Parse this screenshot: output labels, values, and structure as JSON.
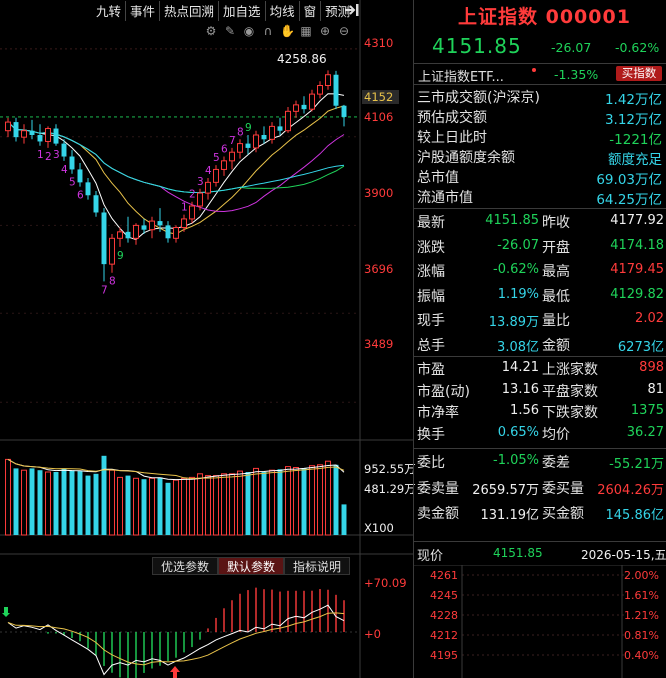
{
  "toolbar": {
    "items": [
      "九转",
      "事件",
      "热点回溯",
      "加自选",
      "均线",
      "窗",
      "预测"
    ]
  },
  "tool_icons": [
    "gear-icon",
    "pencil-icon",
    "eye-icon",
    "magnet-icon",
    "hand-icon",
    "grid-icon",
    "zoom-in-icon",
    "zoom-out-icon"
  ],
  "main_chart": {
    "axis_labels": [
      "4310",
      "4152",
      "4106",
      "3900",
      "3696",
      "3489"
    ],
    "current_price_tag": "4152",
    "high_annotation": "4258.86",
    "volume_axis": [
      "952.55万",
      "481.29万",
      "X100"
    ],
    "indicator_axis": [
      "+70.09",
      "+0"
    ]
  },
  "chart_data": {
    "type": "candlestick",
    "y_ticks": [
      4310,
      4106,
      3900,
      3696,
      3489
    ],
    "y_range": [
      3420,
      4340
    ],
    "candles": [
      {
        "o": 4120,
        "h": 4150,
        "l": 4105,
        "c": 4140
      },
      {
        "o": 4140,
        "h": 4150,
        "l": 4095,
        "c": 4105
      },
      {
        "o": 4105,
        "h": 4135,
        "l": 4090,
        "c": 4120
      },
      {
        "o": 4120,
        "h": 4145,
        "l": 4100,
        "c": 4110
      },
      {
        "o": 4110,
        "h": 4135,
        "l": 4085,
        "c": 4095
      },
      {
        "o": 4095,
        "h": 4130,
        "l": 4080,
        "c": 4125
      },
      {
        "o": 4125,
        "h": 4135,
        "l": 4085,
        "c": 4090
      },
      {
        "o": 4090,
        "h": 4100,
        "l": 4050,
        "c": 4060
      },
      {
        "o": 4060,
        "h": 4075,
        "l": 4020,
        "c": 4030
      },
      {
        "o": 4030,
        "h": 4045,
        "l": 3990,
        "c": 4000
      },
      {
        "o": 4000,
        "h": 4010,
        "l": 3960,
        "c": 3970
      },
      {
        "o": 3970,
        "h": 3980,
        "l": 3920,
        "c": 3930
      },
      {
        "o": 3930,
        "h": 3940,
        "l": 3770,
        "c": 3810
      },
      {
        "o": 3810,
        "h": 3880,
        "l": 3790,
        "c": 3870
      },
      {
        "o": 3870,
        "h": 3895,
        "l": 3850,
        "c": 3885
      },
      {
        "o": 3885,
        "h": 3920,
        "l": 3860,
        "c": 3870
      },
      {
        "o": 3870,
        "h": 3905,
        "l": 3855,
        "c": 3900
      },
      {
        "o": 3900,
        "h": 3915,
        "l": 3880,
        "c": 3890
      },
      {
        "o": 3890,
        "h": 3920,
        "l": 3870,
        "c": 3910
      },
      {
        "o": 3910,
        "h": 3940,
        "l": 3885,
        "c": 3900
      },
      {
        "o": 3900,
        "h": 3910,
        "l": 3860,
        "c": 3870
      },
      {
        "o": 3870,
        "h": 3900,
        "l": 3860,
        "c": 3895
      },
      {
        "o": 3895,
        "h": 3925,
        "l": 3885,
        "c": 3915
      },
      {
        "o": 3915,
        "h": 3955,
        "l": 3905,
        "c": 3945
      },
      {
        "o": 3945,
        "h": 3985,
        "l": 3935,
        "c": 3975
      },
      {
        "o": 3975,
        "h": 4010,
        "l": 3960,
        "c": 4000
      },
      {
        "o": 4000,
        "h": 4040,
        "l": 3990,
        "c": 4030
      },
      {
        "o": 4030,
        "h": 4060,
        "l": 4015,
        "c": 4050
      },
      {
        "o": 4050,
        "h": 4080,
        "l": 4030,
        "c": 4070
      },
      {
        "o": 4070,
        "h": 4100,
        "l": 4055,
        "c": 4090
      },
      {
        "o": 4090,
        "h": 4110,
        "l": 4065,
        "c": 4080
      },
      {
        "o": 4080,
        "h": 4120,
        "l": 4070,
        "c": 4110
      },
      {
        "o": 4110,
        "h": 4130,
        "l": 4090,
        "c": 4100
      },
      {
        "o": 4100,
        "h": 4140,
        "l": 4090,
        "c": 4130
      },
      {
        "o": 4130,
        "h": 4150,
        "l": 4110,
        "c": 4120
      },
      {
        "o": 4120,
        "h": 4175,
        "l": 4115,
        "c": 4165
      },
      {
        "o": 4165,
        "h": 4190,
        "l": 4150,
        "c": 4180
      },
      {
        "o": 4180,
        "h": 4200,
        "l": 4160,
        "c": 4170
      },
      {
        "o": 4170,
        "h": 4215,
        "l": 4165,
        "c": 4205
      },
      {
        "o": 4205,
        "h": 4235,
        "l": 4195,
        "c": 4225
      },
      {
        "o": 4225,
        "h": 4260,
        "l": 4215,
        "c": 4250
      },
      {
        "o": 4250,
        "h": 4259,
        "l": 4170,
        "c": 4178
      },
      {
        "o": 4178,
        "h": 4180,
        "l": 4130,
        "c": 4152
      }
    ],
    "volumes": [
      0.84,
      0.74,
      0.72,
      0.74,
      0.72,
      0.7,
      0.7,
      0.74,
      0.72,
      0.71,
      0.66,
      0.68,
      0.88,
      0.72,
      0.64,
      0.66,
      0.63,
      0.62,
      0.63,
      0.64,
      0.58,
      0.61,
      0.63,
      0.64,
      0.68,
      0.66,
      0.66,
      0.68,
      0.68,
      0.71,
      0.7,
      0.74,
      0.7,
      0.72,
      0.73,
      0.76,
      0.75,
      0.74,
      0.77,
      0.78,
      0.82,
      0.78,
      0.34
    ],
    "nine_turn_labels": [
      {
        "i": 4,
        "t": "1"
      },
      {
        "i": 5,
        "t": "2"
      },
      {
        "i": 6,
        "t": "3"
      },
      {
        "i": 7,
        "t": "4"
      },
      {
        "i": 8,
        "t": "5"
      },
      {
        "i": 9,
        "t": "6"
      },
      {
        "i": 12,
        "t": "7"
      },
      {
        "i": 13,
        "t": "8"
      },
      {
        "i": 14,
        "t": "9"
      },
      {
        "i": 22,
        "t": "1"
      },
      {
        "i": 23,
        "t": "2"
      },
      {
        "i": 24,
        "t": "3"
      },
      {
        "i": 25,
        "t": "4"
      },
      {
        "i": 26,
        "t": "5"
      },
      {
        "i": 27,
        "t": "6"
      },
      {
        "i": 28,
        "t": "7"
      },
      {
        "i": 29,
        "t": "8"
      },
      {
        "i": 30,
        "t": "9"
      }
    ]
  },
  "tabs": {
    "items": [
      "优选参数",
      "默认参数",
      "指标说明"
    ]
  },
  "right": {
    "title": "上证指数 000001",
    "price": "4151.85",
    "change": "-26.07",
    "change_pct": "-0.62%",
    "etf": {
      "name": "上证指数ETF...",
      "pct": "-1.35%",
      "button": "买指数"
    },
    "market_stats": [
      {
        "label": "三市成交额(沪深京)",
        "value": "1.42万亿",
        "color": "c"
      },
      {
        "label": "预估成交额",
        "value": "3.12万亿",
        "color": "c"
      },
      {
        "label": "较上日此时",
        "value": "-1221亿",
        "color": "g"
      },
      {
        "label": "沪股通额度余额",
        "value": "额度充足",
        "color": "c"
      },
      {
        "label": "总市值",
        "value": "69.03万亿",
        "color": "c"
      },
      {
        "label": "流通市值",
        "value": "64.25万亿",
        "color": "c"
      }
    ],
    "quote": [
      {
        "l1": "最新",
        "v1": "4151.85",
        "c1": "g",
        "l2": "昨收",
        "v2": "4177.92",
        "c2": "w"
      },
      {
        "l1": "涨跌",
        "v1": "-26.07",
        "c1": "g",
        "l2": "开盘",
        "v2": "4174.18",
        "c2": "g"
      },
      {
        "l1": "涨幅",
        "v1": "-0.62%",
        "c1": "g",
        "l2": "最高",
        "v2": "4179.45",
        "c2": "r"
      },
      {
        "l1": "振幅",
        "v1": "1.19%",
        "c1": "c",
        "l2": "最低",
        "v2": "4129.82",
        "c2": "g"
      },
      {
        "l1": "现手",
        "v1": "13.89万",
        "c1": "c",
        "l2": "量比",
        "v2": "2.02",
        "c2": "r"
      },
      {
        "l1": "总手",
        "v1": "3.08亿",
        "c1": "c",
        "l2": "金额",
        "v2": "6273亿",
        "c2": "c"
      }
    ],
    "valuation": [
      {
        "l1": "市盈",
        "v1": "14.21",
        "c1": "w",
        "l2": "上涨家数",
        "v2": "898",
        "c2": "r"
      },
      {
        "l1": "市盈(动)",
        "v1": "13.16",
        "c1": "w",
        "l2": "平盘家数",
        "v2": "81",
        "c2": "w"
      },
      {
        "l1": "市净率",
        "v1": "1.56",
        "c1": "w",
        "l2": "下跌家数",
        "v2": "1375",
        "c2": "g"
      },
      {
        "l1": "换手",
        "v1": "0.65%",
        "c1": "c",
        "l2": "均价",
        "v2": "36.27",
        "c2": "g"
      }
    ],
    "orders": [
      {
        "l1": "委比",
        "v1": "-1.05%",
        "c1": "g",
        "l2": "委差",
        "v2": "-55.21万",
        "c2": "g"
      },
      {
        "l1": "委卖量",
        "v1": "2659.57万",
        "c1": "w",
        "l2": "委买量",
        "v2": "2604.26万",
        "c2": "r"
      },
      {
        "l1": "卖金额",
        "v1": "131.19亿",
        "c1": "w",
        "l2": "买金额",
        "v2": "145.86亿",
        "c2": "c"
      }
    ],
    "mini": {
      "label": "现价",
      "price": "4151.85",
      "date": "2026-05-15,五",
      "levels": [
        "4261",
        "4245",
        "4228",
        "4212",
        "4195"
      ],
      "pcts": [
        "2.00%",
        "1.61%",
        "1.21%",
        "0.81%",
        "0.40%"
      ]
    }
  }
}
